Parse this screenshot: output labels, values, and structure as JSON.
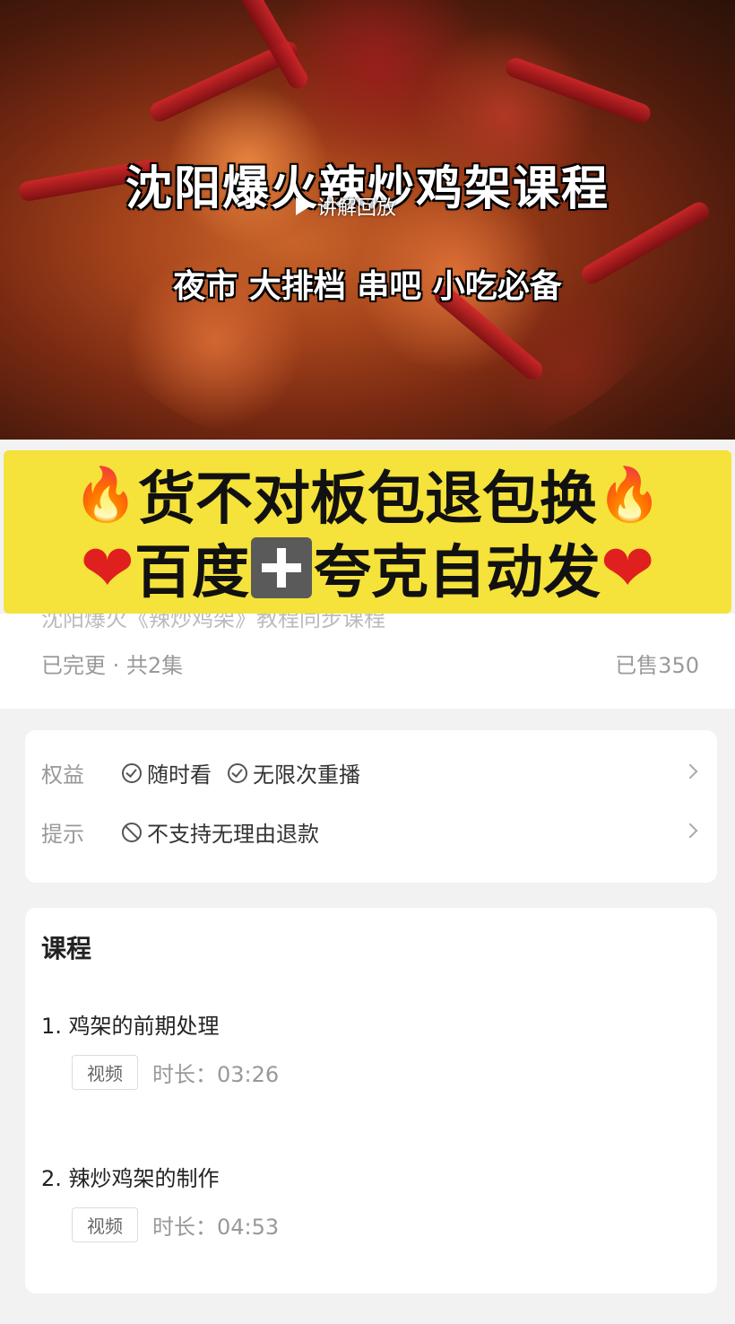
{
  "hero": {
    "title": "沈阳爆火辣炒鸡架课程",
    "replay_label": "讲解回放",
    "subtitle": "夜市 大排档 串吧 小吃必备"
  },
  "promo": {
    "line1": "货不对板包退包换",
    "line2_left": "百度",
    "line2_right": "夸克自动发",
    "fire_emoji": "🔥",
    "heart_emoji": "❤",
    "color": "#f5e23a"
  },
  "course": {
    "title_partial": "沈阳爆火《辣炒鸡架》教程同步课程",
    "status": "已完更 · 共2集",
    "sold": "已售350"
  },
  "rights": {
    "benefit_label": "权益",
    "benefits": [
      "随时看",
      "无限次重播"
    ],
    "notice_label": "提示",
    "notice": "不支持无理由退款"
  },
  "lessons": {
    "section_title": "课程",
    "items": [
      {
        "title": "1. 鸡架的前期处理",
        "tag": "视频",
        "duration": "时长：03:26"
      },
      {
        "title": "2. 辣炒鸡架的制作",
        "tag": "视频",
        "duration": "时长：04:53"
      }
    ]
  }
}
